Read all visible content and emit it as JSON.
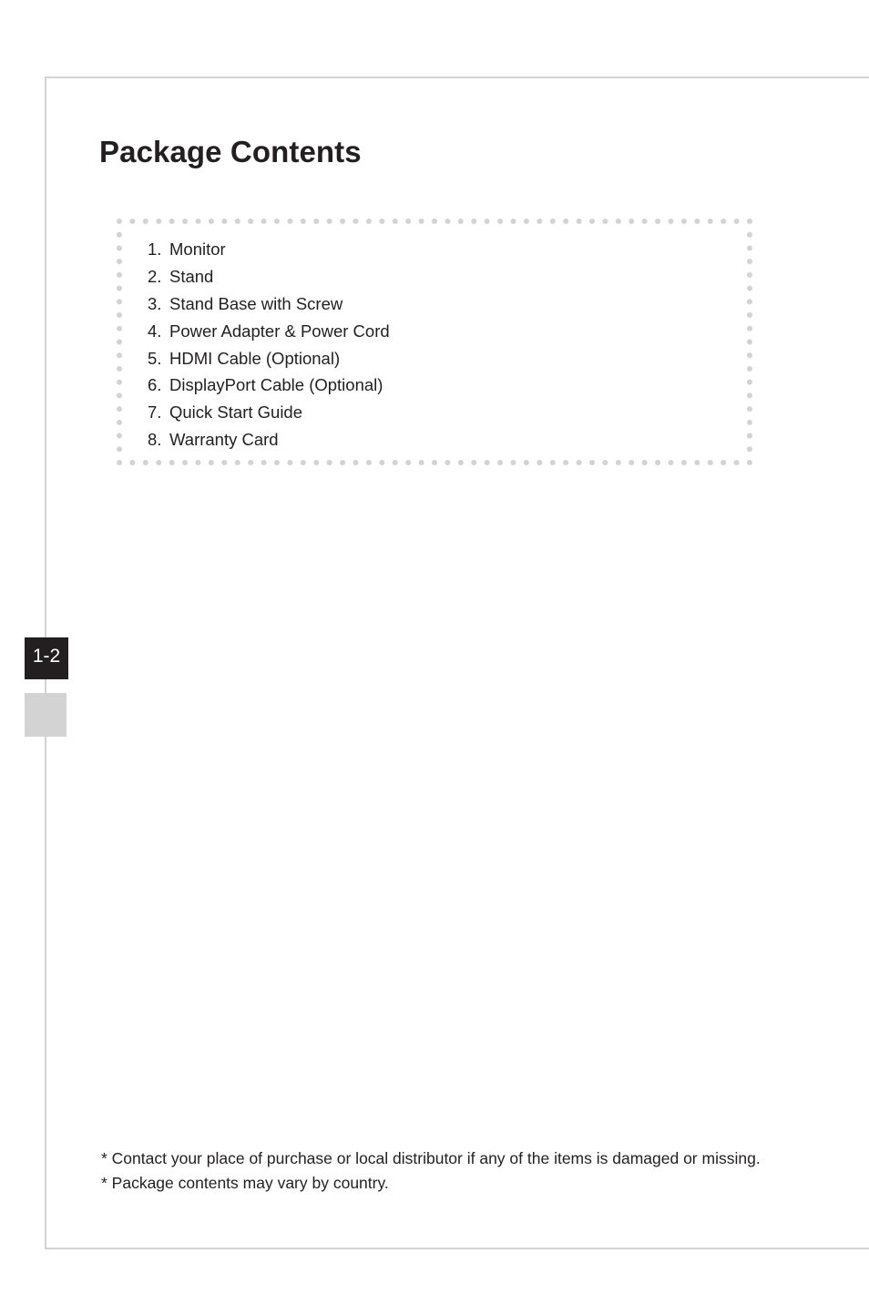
{
  "page": {
    "title": "Package Contents",
    "page_number": "1-2"
  },
  "contents": {
    "items": [
      {
        "number": "1.",
        "label": "Monitor"
      },
      {
        "number": "2.",
        "label": "Stand"
      },
      {
        "number": "3.",
        "label": "Stand Base with Screw"
      },
      {
        "number": "4.",
        "label": "Power Adapter & Power Cord"
      },
      {
        "number": "5.",
        "label": "HDMI Cable (Optional)"
      },
      {
        "number": "6.",
        "label": "DisplayPort Cable (Optional)"
      },
      {
        "number": "7.",
        "label": "Quick Start Guide"
      },
      {
        "number": "8.",
        "label": "Warranty Card"
      }
    ]
  },
  "notes": [
    "* Contact your place of purchase or local distributor if any of the items is damaged or missing.",
    "* Package contents may vary by country."
  ],
  "colors": {
    "text": "#231f20",
    "frame": "#d3d3d3",
    "dots": "#d3d3d3",
    "tab_active": "#231f20",
    "tab_inactive": "#d3d3d3"
  }
}
